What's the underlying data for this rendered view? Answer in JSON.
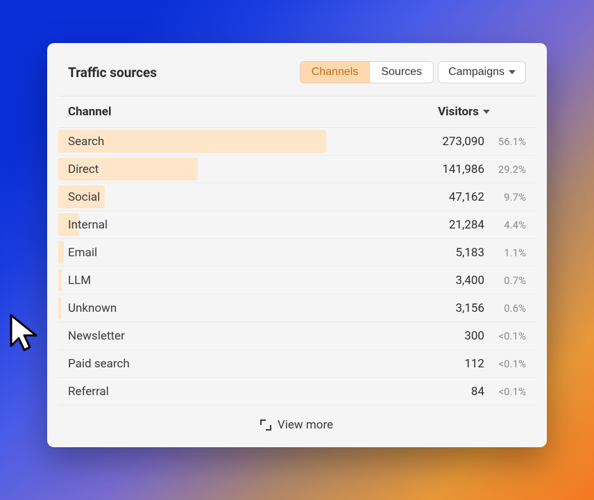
{
  "card": {
    "title": "Traffic sources"
  },
  "tabs": {
    "channels": "Channels",
    "sources": "Sources",
    "campaigns": "Campaigns"
  },
  "columns": {
    "channel": "Channel",
    "visitors": "Visitors"
  },
  "rows": [
    {
      "channel": "Search",
      "visitors": "273,090",
      "percent": "56.1%",
      "bar": 56.1
    },
    {
      "channel": "Direct",
      "visitors": "141,986",
      "percent": "29.2%",
      "bar": 29.2
    },
    {
      "channel": "Social",
      "visitors": "47,162",
      "percent": "9.7%",
      "bar": 9.7
    },
    {
      "channel": "Internal",
      "visitors": "21,284",
      "percent": "4.4%",
      "bar": 4.4
    },
    {
      "channel": "Email",
      "visitors": "5,183",
      "percent": "1.1%",
      "bar": 1.1
    },
    {
      "channel": "LLM",
      "visitors": "3,400",
      "percent": "0.7%",
      "bar": 0.7
    },
    {
      "channel": "Unknown",
      "visitors": "3,156",
      "percent": "0.6%",
      "bar": 0.6
    },
    {
      "channel": "Newsletter",
      "visitors": "300",
      "percent": "<0.1%",
      "bar": 0.05
    },
    {
      "channel": "Paid search",
      "visitors": "112",
      "percent": "<0.1%",
      "bar": 0.05
    },
    {
      "channel": "Referral",
      "visitors": "84",
      "percent": "<0.1%",
      "bar": 0.05
    }
  ],
  "footer": {
    "view_more": "View more"
  },
  "chart_data": {
    "type": "bar",
    "title": "Traffic sources",
    "xlabel": "Channel",
    "ylabel": "Visitors",
    "categories": [
      "Search",
      "Direct",
      "Social",
      "Internal",
      "Email",
      "LLM",
      "Unknown",
      "Newsletter",
      "Paid search",
      "Referral"
    ],
    "values": [
      273090,
      141986,
      47162,
      21284,
      5183,
      3400,
      3156,
      300,
      112,
      84
    ],
    "percent": [
      56.1,
      29.2,
      9.7,
      4.4,
      1.1,
      0.7,
      0.6,
      0.05,
      0.05,
      0.05
    ]
  }
}
